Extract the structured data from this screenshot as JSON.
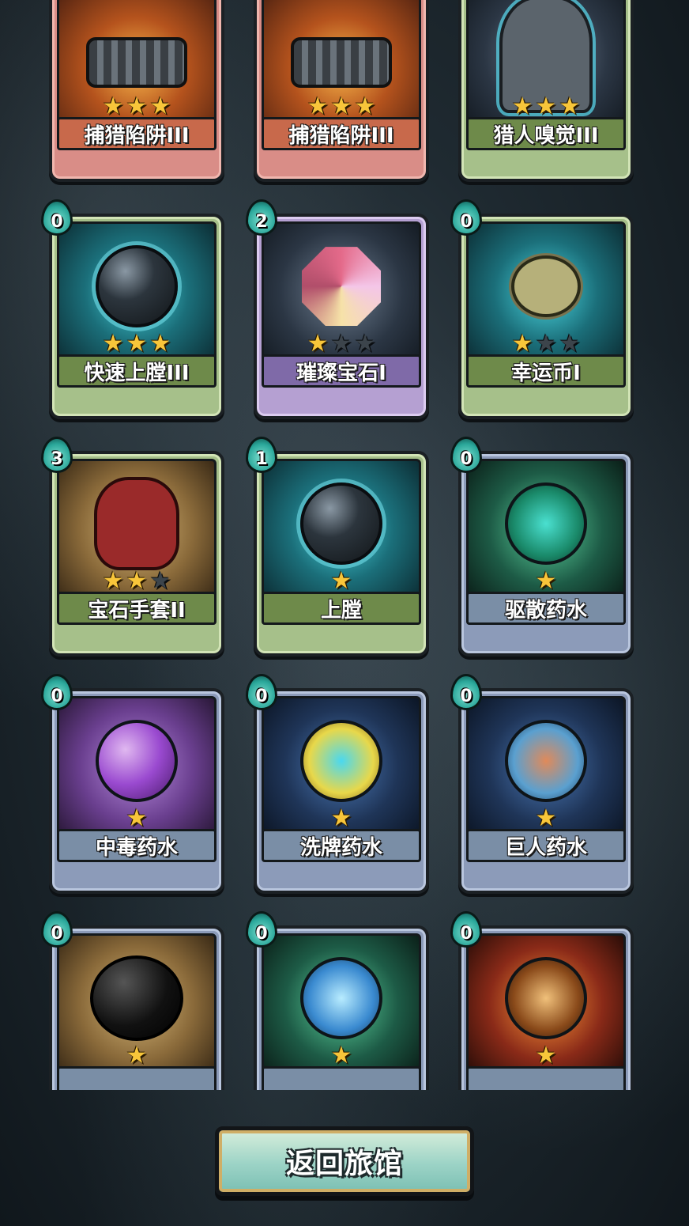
{
  "cards": [
    {
      "name": "捕猎陷阱III",
      "cost": "",
      "stars_filled": 3,
      "stars_total": 3,
      "rarity": "red",
      "art": "orange",
      "icon": "bear-trap-icon"
    },
    {
      "name": "捕猎陷阱III",
      "cost": "",
      "stars_filled": 3,
      "stars_total": 3,
      "rarity": "red",
      "art": "orange",
      "icon": "bear-trap-icon"
    },
    {
      "name": "猎人嗅觉III",
      "cost": "",
      "stars_filled": 3,
      "stars_total": 3,
      "rarity": "green",
      "art": "grey",
      "icon": "hunter-head-icon"
    },
    {
      "name": "快速上膛III",
      "cost": "0",
      "stars_filled": 3,
      "stars_total": 3,
      "rarity": "green",
      "art": "teal",
      "icon": "cannonball-icon"
    },
    {
      "name": "璀璨宝石I",
      "cost": "2",
      "stars_filled": 1,
      "stars_total": 3,
      "rarity": "purple",
      "art": "grey",
      "icon": "gem-icon"
    },
    {
      "name": "幸运币I",
      "cost": "0",
      "stars_filled": 1,
      "stars_total": 3,
      "rarity": "green",
      "art": "teal",
      "icon": "clover-coin-icon"
    },
    {
      "name": "宝石手套II",
      "cost": "3",
      "stars_filled": 2,
      "stars_total": 3,
      "rarity": "green",
      "art": "tan",
      "icon": "gem-gauntlet-icon"
    },
    {
      "name": "上膛",
      "cost": "1",
      "stars_filled": 1,
      "stars_total": 1,
      "rarity": "green",
      "art": "teal",
      "icon": "double-cannonball-icon"
    },
    {
      "name": "驱散药水",
      "cost": "0",
      "stars_filled": 1,
      "stars_total": 1,
      "rarity": "blue",
      "art": "green",
      "icon": "swirl-potion-icon"
    },
    {
      "name": "中毒药水",
      "cost": "0",
      "stars_filled": 1,
      "stars_total": 1,
      "rarity": "blue",
      "art": "purple",
      "icon": "poison-potion-icon"
    },
    {
      "name": "洗牌药水",
      "cost": "0",
      "stars_filled": 1,
      "stars_total": 1,
      "rarity": "blue",
      "art": "navy",
      "icon": "shuffle-potion-icon"
    },
    {
      "name": "巨人药水",
      "cost": "0",
      "stars_filled": 1,
      "stars_total": 1,
      "rarity": "blue",
      "art": "navy",
      "icon": "giant-potion-icon"
    },
    {
      "name": "",
      "cost": "0",
      "stars_filled": 1,
      "stars_total": 1,
      "rarity": "blue",
      "art": "tan",
      "icon": "bomb-icon"
    },
    {
      "name": "",
      "cost": "0",
      "stars_filled": 1,
      "stars_total": 1,
      "rarity": "blue",
      "art": "green",
      "icon": "ice-potion-icon"
    },
    {
      "name": "",
      "cost": "0",
      "stars_filled": 1,
      "stars_total": 1,
      "rarity": "blue",
      "art": "red",
      "icon": "fire-potion-icon"
    }
  ],
  "return_button": {
    "label": "返回旅馆"
  },
  "colors": {
    "star": "#f8c63a",
    "badge": "#2aa79a",
    "button": "#9cd3c6"
  }
}
